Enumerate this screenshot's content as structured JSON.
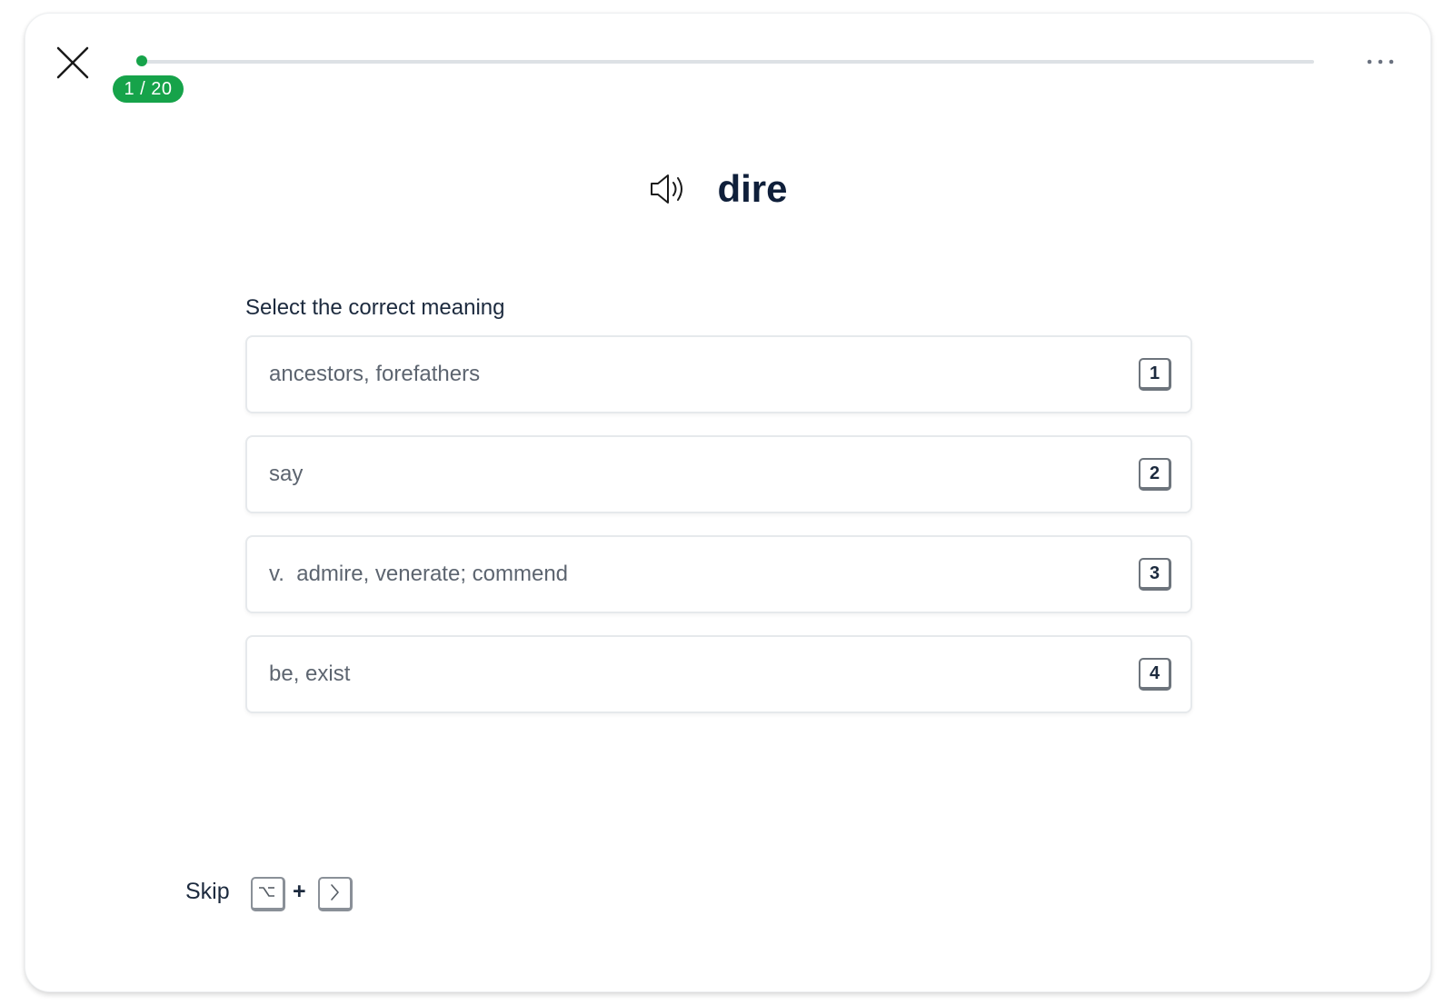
{
  "header": {
    "close_icon": "close-icon",
    "progress": {
      "current": 1,
      "total": 20,
      "label": "1 / 20",
      "fraction": 0.05
    },
    "more_icon": "more-horizontal-icon"
  },
  "question": {
    "speaker_icon": "speaker-icon",
    "word": "dire",
    "prompt": "Select the correct meaning"
  },
  "options": [
    {
      "text": "ancestors, forefathers",
      "key": "1"
    },
    {
      "text": "say",
      "key": "2"
    },
    {
      "text": "v.  admire, venerate; commend",
      "key": "3"
    },
    {
      "text": "be, exist",
      "key": "4"
    }
  ],
  "footer": {
    "skip_label": "Skip",
    "plus": "+",
    "option_key_icon": "option-key-icon",
    "arrow_key_icon": "chevron-right-icon"
  },
  "colors": {
    "accent_green": "#16a34a",
    "title": "#0f1f3a",
    "option_text": "#5d6570",
    "border": "#e6e9ec"
  }
}
